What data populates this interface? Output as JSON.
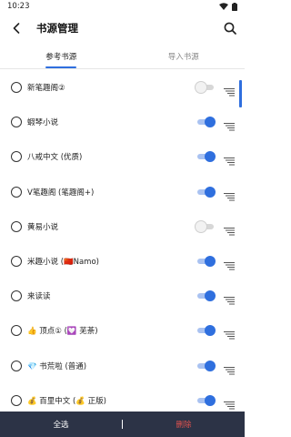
{
  "status": {
    "time": "10:23",
    "icons": [
      "wifi-icon",
      "battery-icon"
    ]
  },
  "header": {
    "title": "书源管理",
    "back_icon": "back-arrow-icon",
    "search_icon": "search-icon"
  },
  "tabs": [
    {
      "label": "参考书源",
      "active": true
    },
    {
      "label": "导入书源",
      "active": false
    }
  ],
  "sources": [
    {
      "label": "新笔趣阁②",
      "enabled": false
    },
    {
      "label": "蝦琴小说",
      "enabled": true
    },
    {
      "label": "八戒中文 (优质)",
      "enabled": true
    },
    {
      "label": "V笔趣阁 (笔趣阁+)",
      "enabled": true
    },
    {
      "label": "黄易小说",
      "enabled": false
    },
    {
      "label": "米趣小说 (🇨🇳Namo)",
      "enabled": true
    },
    {
      "label": "来读读",
      "enabled": true
    },
    {
      "label": "👍 顶点① (💟 芜荼)",
      "enabled": true
    },
    {
      "label": "💎 书荒啦 (普通)",
      "enabled": true
    },
    {
      "label": "💰 百里中文 (💰 正版)",
      "enabled": true
    }
  ],
  "bottom": {
    "select_all": "全选",
    "delete": "删除"
  },
  "colors": {
    "accent": "#2f6fde",
    "bottom_bar": "#2c3346",
    "delete": "#e0524e"
  }
}
